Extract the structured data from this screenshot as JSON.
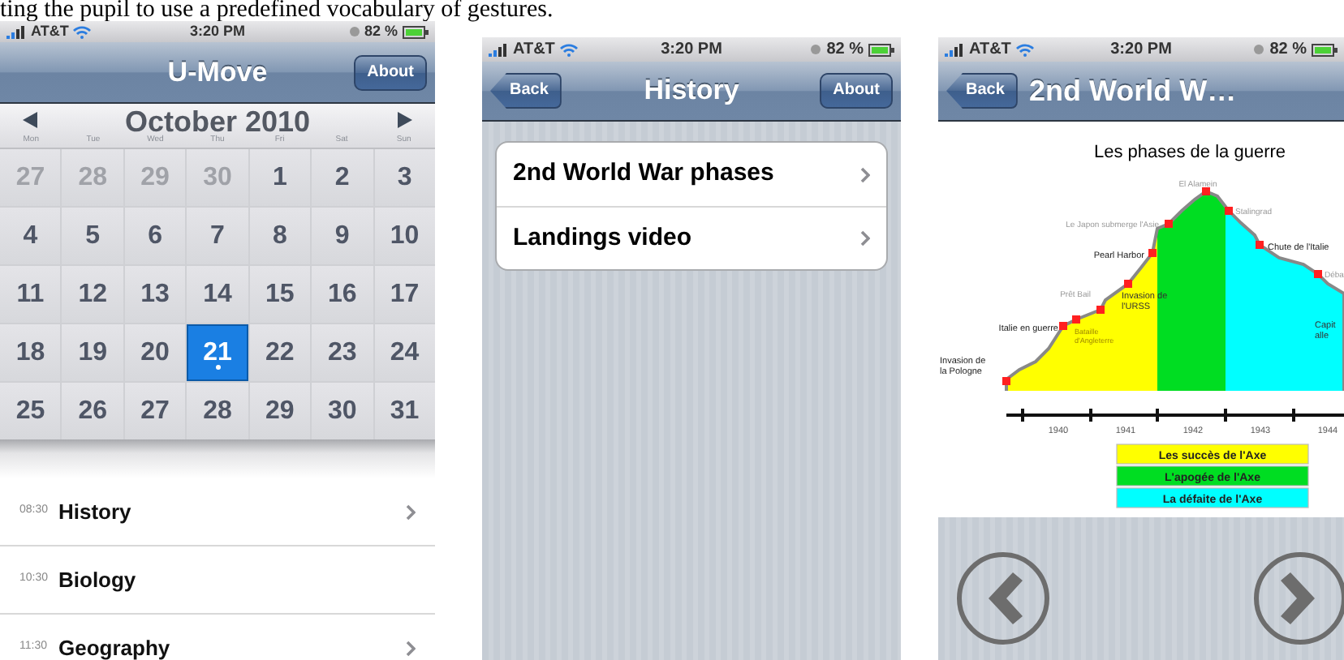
{
  "caption": "ting the pupil to use a predefined vocabulary of gestures.",
  "calendar_screen": {
    "status_bar": {
      "carrier": "AT&T",
      "time": "3:20 PM",
      "battery": "82 %"
    },
    "title": "U-Move",
    "right_button": "About",
    "month": "October 2010",
    "weekdays": [
      "Mon",
      "Tue",
      "Wed",
      "Thu",
      "Fri",
      "Sat",
      "Sun"
    ],
    "days": [
      {
        "label": "27",
        "outside": true,
        "selected": false,
        "has_event": false
      },
      {
        "label": "28",
        "outside": true,
        "selected": false,
        "has_event": false
      },
      {
        "label": "29",
        "outside": true,
        "selected": false,
        "has_event": false
      },
      {
        "label": "30",
        "outside": true,
        "selected": false,
        "has_event": false
      },
      {
        "label": "1",
        "outside": false,
        "selected": false,
        "has_event": false
      },
      {
        "label": "2",
        "outside": false,
        "selected": false,
        "has_event": false
      },
      {
        "label": "3",
        "outside": false,
        "selected": false,
        "has_event": false
      },
      {
        "label": "4",
        "outside": false,
        "selected": false,
        "has_event": false
      },
      {
        "label": "5",
        "outside": false,
        "selected": false,
        "has_event": false
      },
      {
        "label": "6",
        "outside": false,
        "selected": false,
        "has_event": false
      },
      {
        "label": "7",
        "outside": false,
        "selected": false,
        "has_event": false
      },
      {
        "label": "8",
        "outside": false,
        "selected": false,
        "has_event": false
      },
      {
        "label": "9",
        "outside": false,
        "selected": false,
        "has_event": false
      },
      {
        "label": "10",
        "outside": false,
        "selected": false,
        "has_event": false
      },
      {
        "label": "11",
        "outside": false,
        "selected": false,
        "has_event": false
      },
      {
        "label": "12",
        "outside": false,
        "selected": false,
        "has_event": false
      },
      {
        "label": "13",
        "outside": false,
        "selected": false,
        "has_event": false
      },
      {
        "label": "14",
        "outside": false,
        "selected": false,
        "has_event": false
      },
      {
        "label": "15",
        "outside": false,
        "selected": false,
        "has_event": false
      },
      {
        "label": "16",
        "outside": false,
        "selected": false,
        "has_event": false
      },
      {
        "label": "17",
        "outside": false,
        "selected": false,
        "has_event": false
      },
      {
        "label": "18",
        "outside": false,
        "selected": false,
        "has_event": false
      },
      {
        "label": "19",
        "outside": false,
        "selected": false,
        "has_event": false
      },
      {
        "label": "20",
        "outside": false,
        "selected": false,
        "has_event": false
      },
      {
        "label": "21",
        "outside": false,
        "selected": true,
        "has_event": true
      },
      {
        "label": "22",
        "outside": false,
        "selected": false,
        "has_event": false
      },
      {
        "label": "23",
        "outside": false,
        "selected": false,
        "has_event": false
      },
      {
        "label": "24",
        "outside": false,
        "selected": false,
        "has_event": false
      },
      {
        "label": "25",
        "outside": false,
        "selected": false,
        "has_event": false
      },
      {
        "label": "26",
        "outside": false,
        "selected": false,
        "has_event": false
      },
      {
        "label": "27",
        "outside": false,
        "selected": false,
        "has_event": false
      },
      {
        "label": "28",
        "outside": false,
        "selected": false,
        "has_event": false
      },
      {
        "label": "29",
        "outside": false,
        "selected": false,
        "has_event": false
      },
      {
        "label": "30",
        "outside": false,
        "selected": false,
        "has_event": false
      },
      {
        "label": "31",
        "outside": false,
        "selected": false,
        "has_event": false
      }
    ],
    "events": [
      {
        "time": "08:30",
        "title": "History",
        "chevron": true
      },
      {
        "time": "10:30",
        "title": "Biology",
        "chevron": false
      },
      {
        "time": "11:30",
        "title": "Geography",
        "chevron": true
      }
    ]
  },
  "history_screen": {
    "status_bar": {
      "carrier": "AT&T",
      "time": "3:20 PM",
      "battery": "82 %"
    },
    "back_button": "Back",
    "title": "History",
    "right_button": "About",
    "items": [
      {
        "label": "2nd World War phases"
      },
      {
        "label": "Landings video"
      }
    ]
  },
  "chart_screen": {
    "status_bar": {
      "carrier": "AT&T",
      "time": "3:20 PM",
      "battery": "82 %"
    },
    "back_button": "Back",
    "title": "2nd World W…",
    "chart_title": "Les phases de la guerre",
    "event_labels": [
      {
        "lines": [
          "El Alamein"
        ]
      },
      {
        "lines": [
          "Stalingrad"
        ]
      },
      {
        "lines": [
          "Le Japon submerge l'Asie"
        ]
      },
      {
        "lines": [
          "Chute de l'Italie"
        ]
      },
      {
        "lines": [
          "Pearl Harbor"
        ]
      },
      {
        "lines": [
          "Déba"
        ]
      },
      {
        "lines": [
          "Prêt Bail"
        ]
      },
      {
        "lines": [
          "Invasion de",
          "l'URSS"
        ]
      },
      {
        "lines": [
          "Capit",
          "alle"
        ]
      },
      {
        "lines": [
          "Italie en guerre"
        ]
      },
      {
        "lines": [
          "Bataille",
          "d'Angleterre"
        ]
      },
      {
        "lines": [
          "Invasion de",
          "la Pologne"
        ]
      }
    ],
    "years": [
      "1940",
      "1941",
      "1942",
      "1943",
      "1944"
    ],
    "legend": [
      {
        "label": "Les succès de l'Axe",
        "color": "#ffff00"
      },
      {
        "label": "L'apogée de l'Axe",
        "color": "#00dd22"
      },
      {
        "label": "La défaite de l'Axe",
        "color": "#00ffff"
      }
    ]
  }
}
